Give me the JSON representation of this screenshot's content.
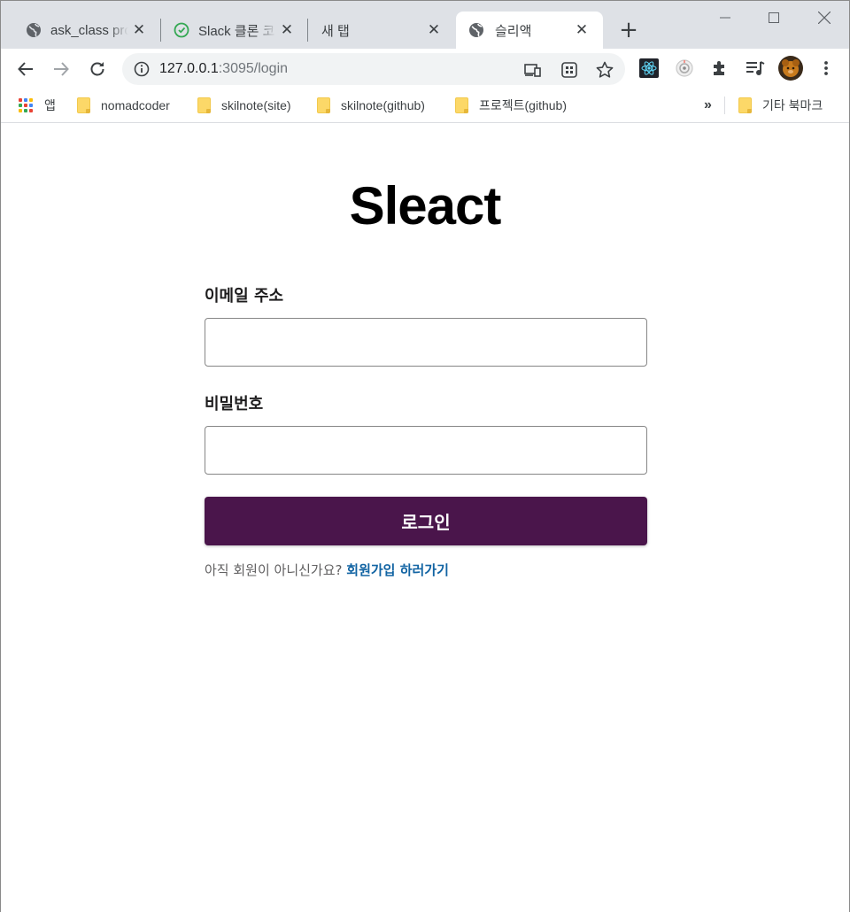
{
  "browser": {
    "tabs": [
      {
        "label": "ask_class pro",
        "favicon": "globe-icon",
        "active": false
      },
      {
        "label": "Slack 클론 코",
        "favicon": "timer-icon",
        "active": false
      },
      {
        "label": "새 탭",
        "favicon": "",
        "active": false
      },
      {
        "label": "슬리액",
        "favicon": "globe-icon",
        "active": true
      }
    ],
    "new_tab_label": "+",
    "close_glyph": "✕",
    "address": {
      "host": "127.0.0.1",
      "path": ":3095/login"
    },
    "bookmarks": [
      {
        "label": "앱",
        "icon": "apps-grid-icon"
      },
      {
        "label": "nomadcoder",
        "icon": "folder-icon"
      },
      {
        "label": "skilnote(site)",
        "icon": "folder-icon"
      },
      {
        "label": "skilnote(github)",
        "icon": "folder-icon"
      },
      {
        "label": "프로젝트(github)",
        "icon": "folder-icon"
      }
    ],
    "bookmarks_overflow": "»",
    "other_bookmarks": "기타 북마크"
  },
  "page": {
    "logo": "Sleact",
    "email_label": "이메일 주소",
    "email_value": "",
    "password_label": "비밀번호",
    "password_value": "",
    "login_button": "로그인",
    "signup_prompt": "아직 회원이 아니신가요?",
    "signup_link": "회원가입 하러가기"
  },
  "colors": {
    "brand": "#4a154b",
    "link": "#1264a3"
  }
}
